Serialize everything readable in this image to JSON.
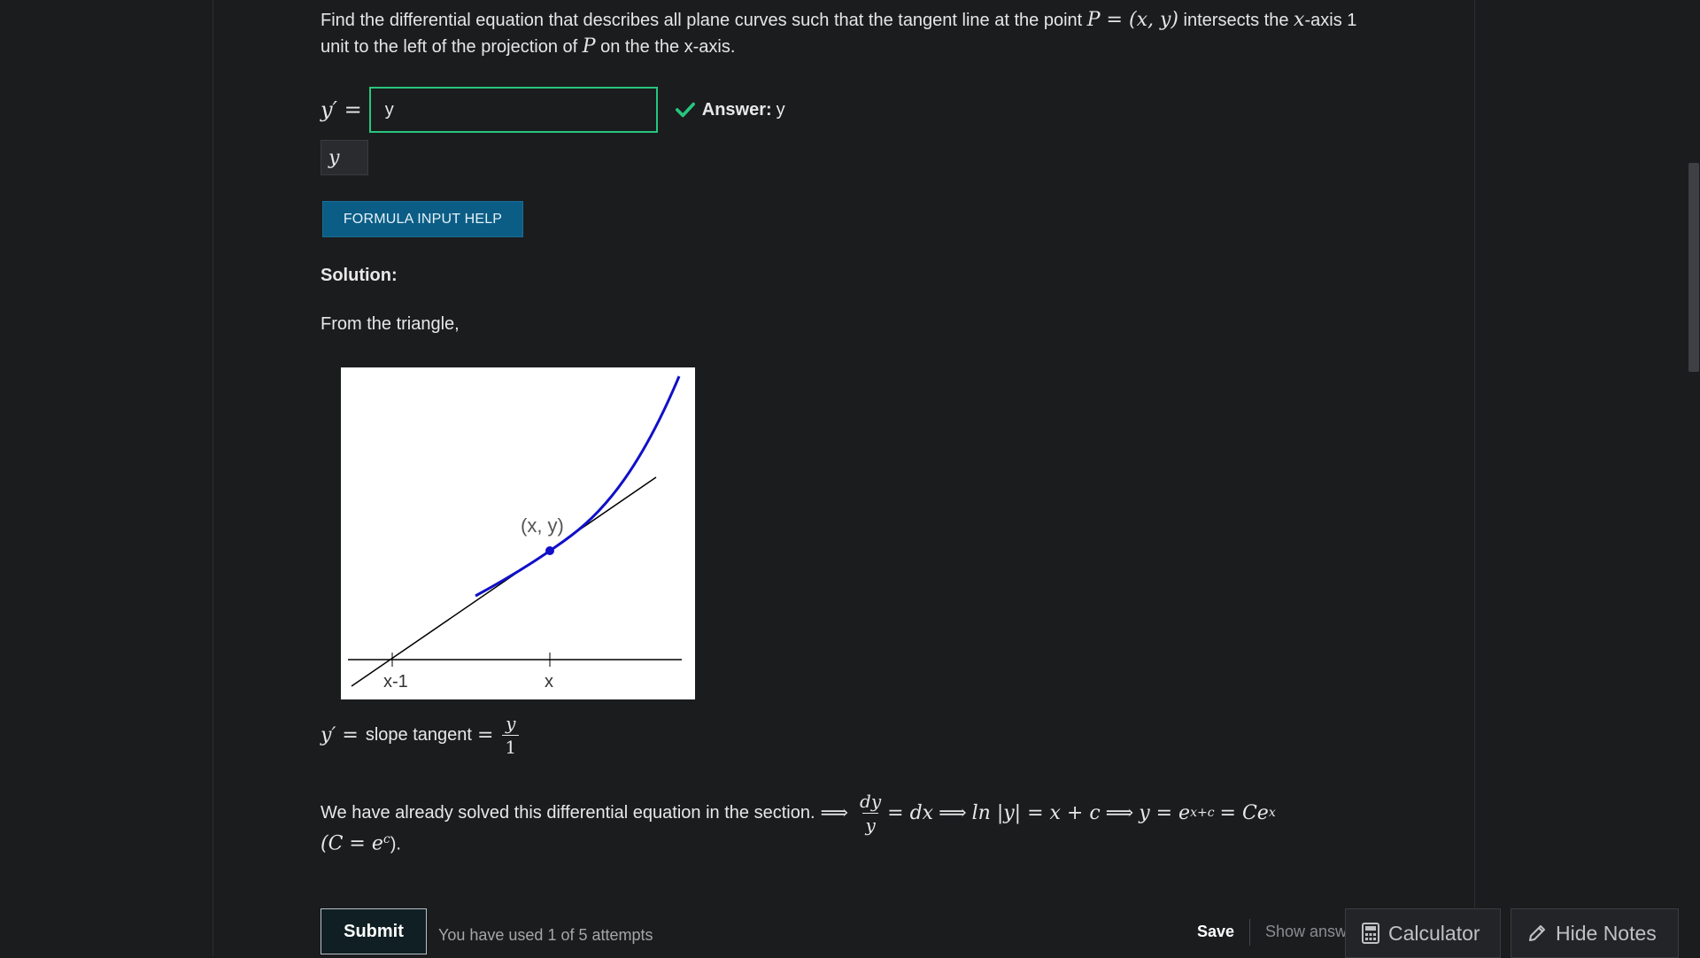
{
  "question": {
    "text_a": "Find the differential equation that describes all plane curves such that the tangent line at the point ",
    "math_p": "P = (x, y)",
    "text_b": " intersects the ",
    "math_x": "x",
    "text_c": "-axis 1 unit to the left of the projection of ",
    "math_p2": "P",
    "text_d": " on the the x-axis."
  },
  "input": {
    "prefix": "y′ =",
    "value": "y",
    "answer_label": "Answer:",
    "answer_value": "y",
    "preview": "y"
  },
  "buttons": {
    "formula_help": "FORMULA INPUT HELP",
    "submit": "Submit",
    "save": "Save",
    "show_answer": "Show answer",
    "calculator": "Calculator",
    "hide_notes": "Hide Notes"
  },
  "solution": {
    "title": "Solution:",
    "intro": "From the triangle,",
    "point_label": "(x, y)",
    "tick_left": "x-1",
    "tick_right": "x",
    "slope_prefix": "y′ =",
    "slope_text": "slope tangent",
    "slope_eq": "=",
    "slope_num": "y",
    "slope_den": "1",
    "solved_text": "We have already solved this differential equation in the section.",
    "implies": "⟹",
    "frac_num": "dy",
    "frac_den": "y",
    "eq_dx": "= dx",
    "ln_part": "ln |y| = x + c",
    "y_eq": "y = e",
    "exp1": "x+c",
    "ce": "= Ce",
    "exp2": "x",
    "c_def_open": "(C = e",
    "c_exp": "c",
    "c_def_close": ")."
  },
  "status": {
    "attempts": "You have used 1 of 5 attempts"
  },
  "colors": {
    "correct_border": "#27c57f",
    "help_button": "#0b5d86",
    "curve": "#1010c8"
  }
}
